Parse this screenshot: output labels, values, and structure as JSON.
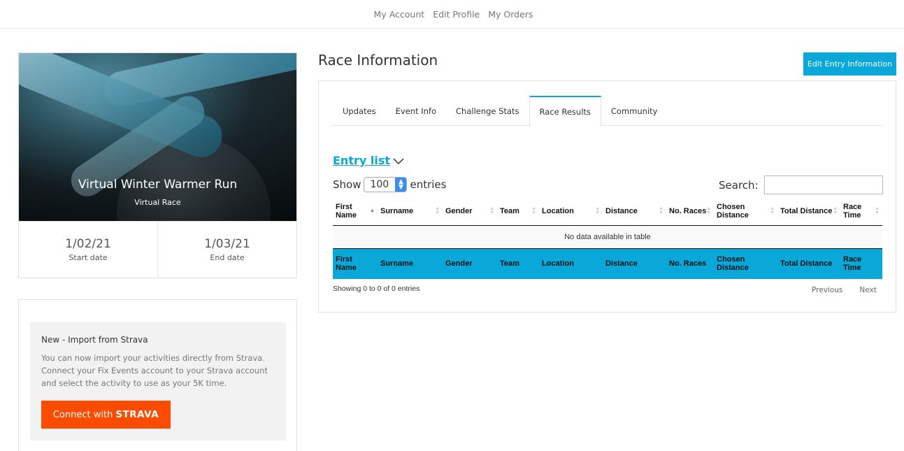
{
  "nav": {
    "items": [
      "My Account",
      "Edit Profile",
      "My Orders"
    ]
  },
  "event": {
    "title": "Virtual Winter Warmer Run",
    "subtitle": "Virtual Race",
    "start_date": "1/02/21",
    "start_label": "Start date",
    "end_date": "1/03/21",
    "end_label": "End date"
  },
  "strava": {
    "heading": "New - Import from Strava",
    "text": "You can now import your activities directly from Strava. Connect your Fix Events account to your Strava account and select the activity to use as your 5K time.",
    "button_prefix": "Connect with",
    "button_brand": "STRAVA"
  },
  "race": {
    "title": "Race Information",
    "edit_button": "Edit Entry Information",
    "tabs": [
      "Updates",
      "Event Info",
      "Challenge Stats",
      "Race Results",
      "Community"
    ],
    "active_tab": 3,
    "entry_list": "Entry list",
    "show_label": "Show",
    "show_value": "100",
    "entries_label": "entries",
    "search_label": "Search:",
    "search_value": "",
    "columns": [
      "First Name",
      "Surname",
      "Gender",
      "Team",
      "Location",
      "Distance",
      "No. Races",
      "Chosen Distance",
      "Total Distance",
      "Race Time"
    ],
    "empty_message": "No data available in table",
    "info": "Showing 0 to 0 of 0 entries",
    "previous": "Previous",
    "next": "Next"
  },
  "colors": {
    "accent": "#0aa7d9",
    "strava": "#fc4c02"
  }
}
